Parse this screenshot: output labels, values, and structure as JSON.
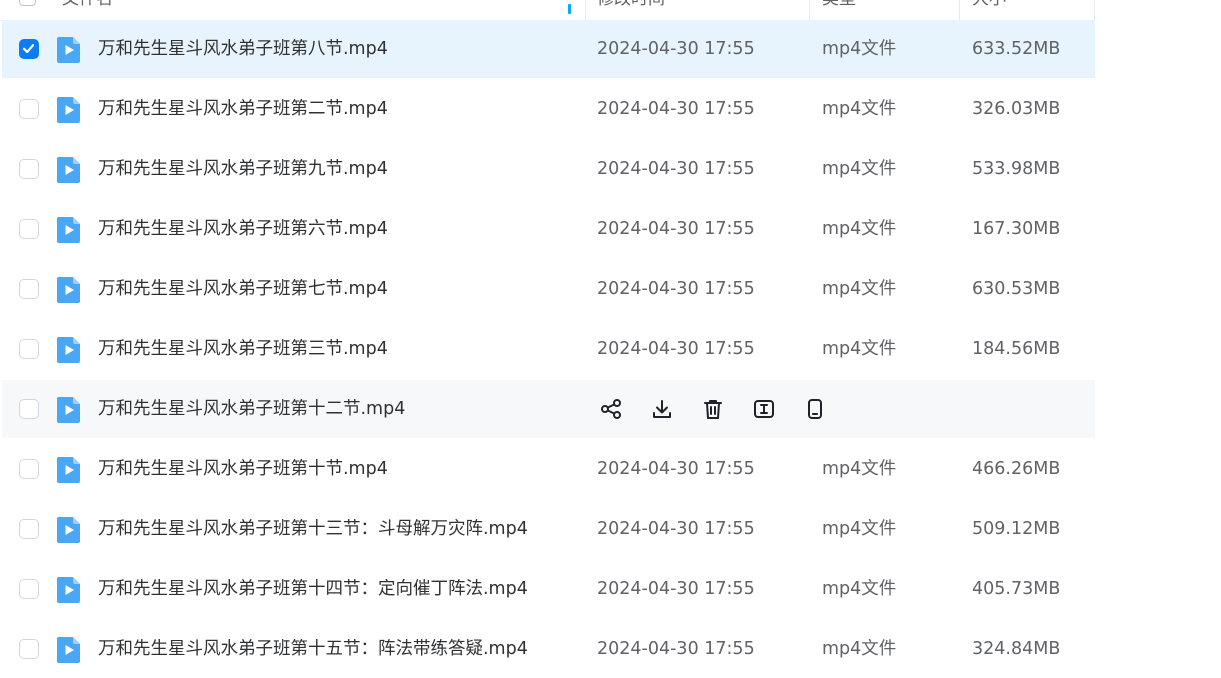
{
  "header": {
    "name_col": "文件名",
    "time_col": "修改时间",
    "type_col": "类型",
    "size_col": "大小"
  },
  "colors": {
    "accent": "#0d7cf2",
    "selected_row_bg": "#e8f4fd",
    "hover_row_bg": "#f7f8fa",
    "file_icon": "#4aa7f5"
  },
  "hover_actions": [
    "share-icon",
    "download-icon",
    "delete-icon",
    "rename-icon",
    "mobile-icon"
  ],
  "files": [
    {
      "name": "万和先生星斗风水弟子班第八节.mp4",
      "time": "2024-04-30 17:55",
      "type": "mp4文件",
      "size": "633.52MB",
      "selected": true
    },
    {
      "name": "万和先生星斗风水弟子班第二节.mp4",
      "time": "2024-04-30 17:55",
      "type": "mp4文件",
      "size": "326.03MB"
    },
    {
      "name": "万和先生星斗风水弟子班第九节.mp4",
      "time": "2024-04-30 17:55",
      "type": "mp4文件",
      "size": "533.98MB"
    },
    {
      "name": "万和先生星斗风水弟子班第六节.mp4",
      "time": "2024-04-30 17:55",
      "type": "mp4文件",
      "size": "167.30MB"
    },
    {
      "name": "万和先生星斗风水弟子班第七节.mp4",
      "time": "2024-04-30 17:55",
      "type": "mp4文件",
      "size": "630.53MB"
    },
    {
      "name": "万和先生星斗风水弟子班第三节.mp4",
      "time": "2024-04-30 17:55",
      "type": "mp4文件",
      "size": "184.56MB"
    },
    {
      "name": "万和先生星斗风水弟子班第十二节.mp4",
      "time": "",
      "type": "",
      "size": "",
      "hovered": true
    },
    {
      "name": "万和先生星斗风水弟子班第十节.mp4",
      "time": "2024-04-30 17:55",
      "type": "mp4文件",
      "size": "466.26MB"
    },
    {
      "name": "万和先生星斗风水弟子班第十三节：斗母解万灾阵.mp4",
      "time": "2024-04-30 17:55",
      "type": "mp4文件",
      "size": "509.12MB"
    },
    {
      "name": "万和先生星斗风水弟子班第十四节：定向催丁阵法.mp4",
      "time": "2024-04-30 17:55",
      "type": "mp4文件",
      "size": "405.73MB"
    },
    {
      "name": "万和先生星斗风水弟子班第十五节：阵法带练答疑.mp4",
      "time": "2024-04-30 17:55",
      "type": "mp4文件",
      "size": "324.84MB"
    }
  ]
}
